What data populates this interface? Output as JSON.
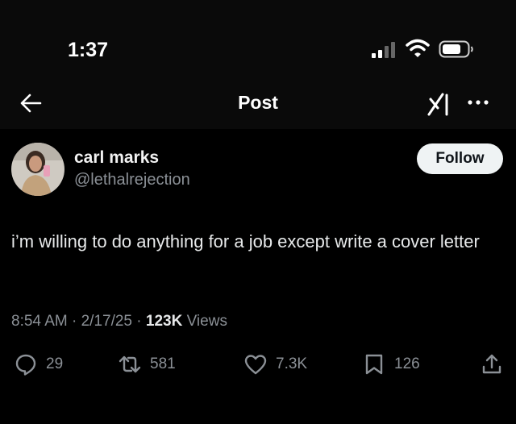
{
  "status_bar": {
    "time": "1:37"
  },
  "nav": {
    "title": "Post"
  },
  "author": {
    "name": "carl marks",
    "handle": "@lethalrejection"
  },
  "follow_label": "Follow",
  "tweet": {
    "text": "i’m willing to do anything for a job except write a cover letter"
  },
  "meta": {
    "time": "8:54 AM",
    "sep1": " · ",
    "date": "2/17/25",
    "sep2": " · ",
    "views": "123K",
    "views_label": " Views"
  },
  "actions": {
    "replies": "29",
    "reposts": "581",
    "likes": "7.3K",
    "bookmarks": "126"
  },
  "icons": {
    "back": "arrow-left-icon",
    "grok": "grok-icon",
    "more": "more-icon",
    "reply": "reply-icon",
    "repost": "repost-icon",
    "like": "heart-icon",
    "bookmark": "bookmark-icon",
    "share": "share-icon"
  },
  "colors": {
    "background": "#000000",
    "text": "#e7e9ea",
    "secondary": "#8b9096",
    "follow_bg": "#eff3f4"
  }
}
